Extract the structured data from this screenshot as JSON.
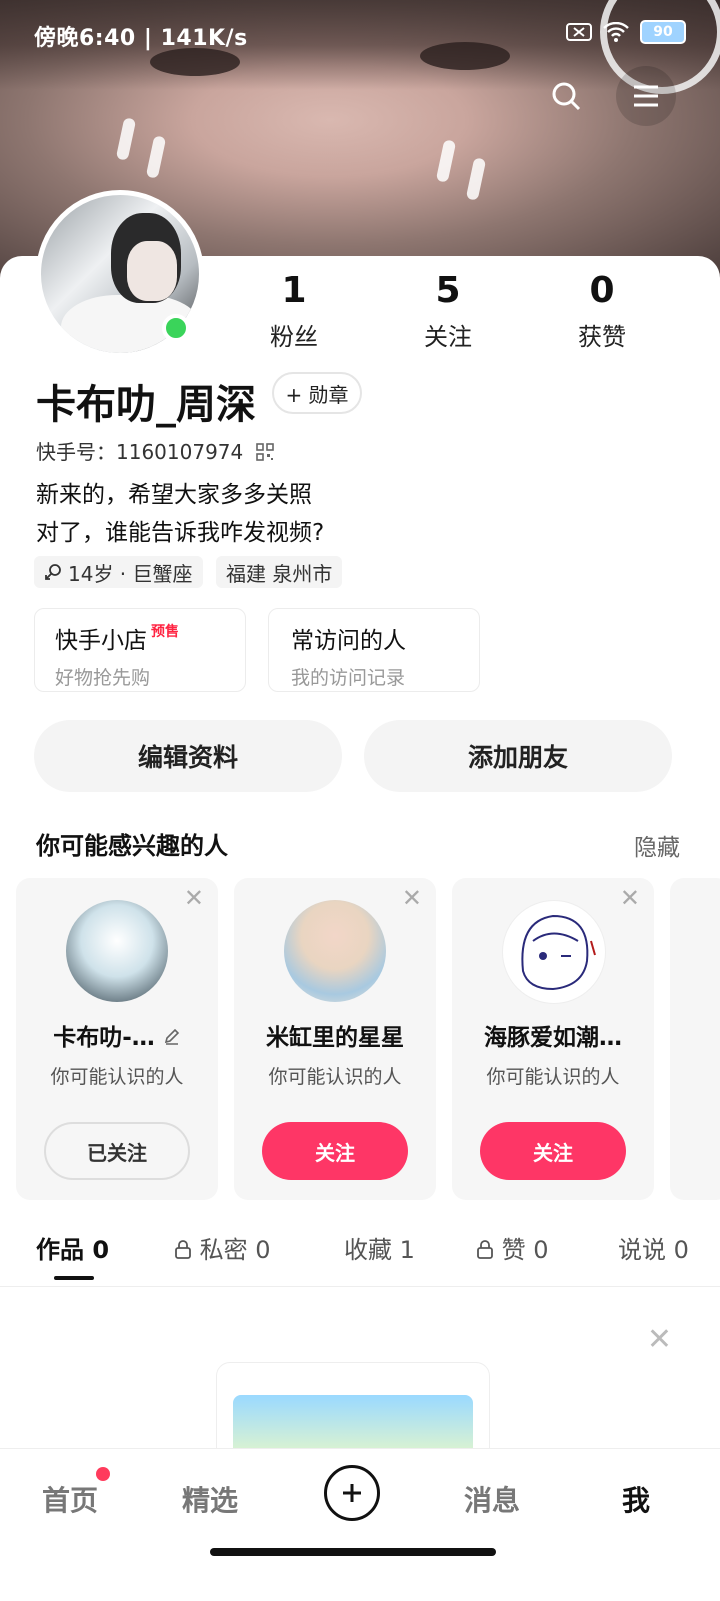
{
  "status": {
    "time": "傍晚6:40 | 141K/s",
    "battery": "90"
  },
  "profile": {
    "name": "卡布叻_周深",
    "badge_label": "+ 勋章",
    "id_line": "快手号：1160107974",
    "bio_line1": "新来的，希望大家多多关照",
    "bio_line2": "对了，谁能告诉我咋发视频?",
    "tag_age": "14岁 · 巨蟹座",
    "tag_location": "福建 泉州市"
  },
  "stats": [
    {
      "num": "1",
      "label": "粉丝"
    },
    {
      "num": "5",
      "label": "关注"
    },
    {
      "num": "0",
      "label": "获赞"
    }
  ],
  "cards": {
    "shop_title": "快手小店",
    "shop_badge": "预售",
    "shop_sub": "好物抢先购",
    "visit_title": "常访问的人",
    "visit_sub": "我的访问记录"
  },
  "buttons": {
    "edit": "编辑资料",
    "add_friend": "添加朋友"
  },
  "recommend": {
    "title": "你可能感兴趣的人",
    "hide": "隐藏",
    "items": [
      {
        "name": "卡布叻-…",
        "sub": "你可能认识的人",
        "btn": "已关注"
      },
      {
        "name": "米缸里的星星",
        "sub": "你可能认识的人",
        "btn": "关注"
      },
      {
        "name": "海豚爱如潮…",
        "sub": "你可能认识的人",
        "btn": "关注"
      }
    ]
  },
  "tabs": [
    {
      "label": "作品 0"
    },
    {
      "label": "私密 0"
    },
    {
      "label": "收藏 1"
    },
    {
      "label": "赞 0"
    },
    {
      "label": "说说 0"
    }
  ],
  "nav": {
    "home": "首页",
    "featured": "精选",
    "messages": "消息",
    "me": "我"
  },
  "colors": {
    "accent": "#fe3666",
    "online": "#3ad45a"
  }
}
